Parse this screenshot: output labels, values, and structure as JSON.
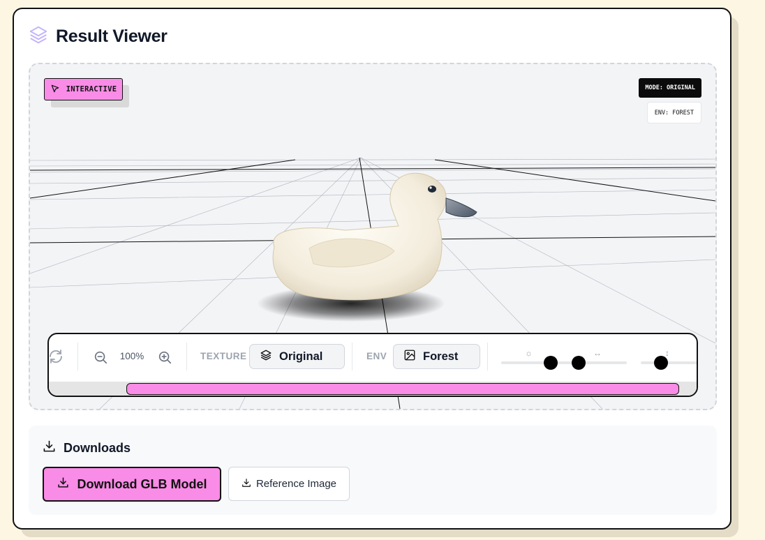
{
  "app": {
    "title": "Result Viewer",
    "title_icon": "layers-icon",
    "accent_color": "#f98ce6"
  },
  "viewer": {
    "interactive_badge": "INTERACTIVE",
    "interactive_icon": "cursor-pointer-icon",
    "mode_tag": "MODE: ORIGINAL",
    "env_tag": "ENV: FOREST",
    "model_subject": "rubber-duck-3d-model"
  },
  "controls": {
    "zoom_value": "100%",
    "texture_label": "TEXTURE",
    "texture_value": "Original",
    "env_label": "ENV",
    "env_value": "Forest",
    "sliders": [
      {
        "name": "brightness",
        "icon": "sun-icon",
        "symbol": "☼",
        "value": 0.4
      },
      {
        "name": "horizontal",
        "icon": "horizontal-arrows-icon",
        "symbol": "↔",
        "value": 0.6
      },
      {
        "name": "vertical",
        "icon": "vertical-arrows-icon",
        "symbol": "↕",
        "value": 0.35
      }
    ]
  },
  "downloads": {
    "heading": "Downloads",
    "primary_button": "Download GLB Model",
    "secondary_button": "Reference Image"
  }
}
